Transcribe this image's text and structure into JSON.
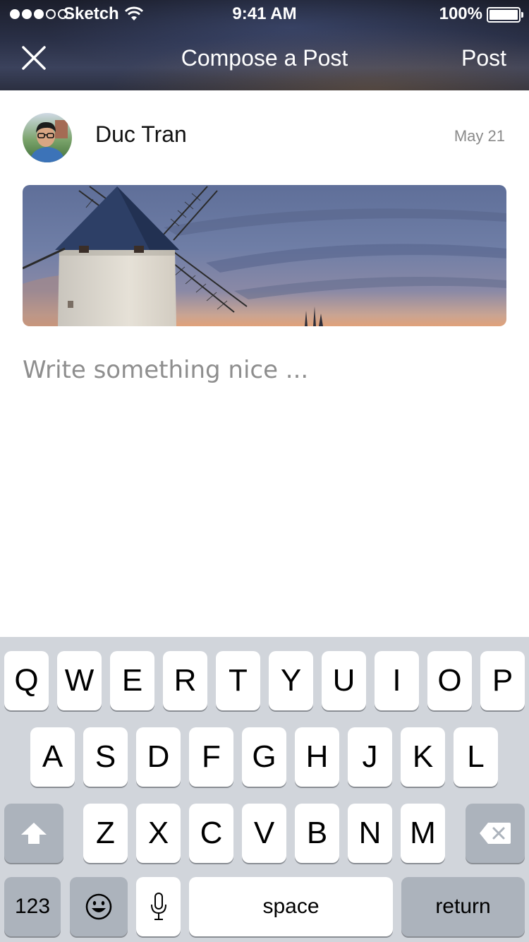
{
  "status_bar": {
    "signal_dots": [
      true,
      true,
      true,
      false,
      false
    ],
    "carrier": "Sketch",
    "time": "9:41 AM",
    "battery": "100%",
    "battery_level": 1.0
  },
  "nav": {
    "close_icon": "close-icon",
    "title": "Compose a Post",
    "post_label": "Post"
  },
  "post": {
    "author": "Duc Tran",
    "date": "May 21",
    "placeholder": "Write something nice ..."
  },
  "keyboard": {
    "row1": [
      "Q",
      "W",
      "E",
      "R",
      "T",
      "Y",
      "U",
      "I",
      "O",
      "P"
    ],
    "row2": [
      "A",
      "S",
      "D",
      "F",
      "G",
      "H",
      "J",
      "K",
      "L"
    ],
    "row3": [
      "Z",
      "X",
      "C",
      "V",
      "B",
      "N",
      "M"
    ],
    "numbers_label": "123",
    "space_label": "space",
    "return_label": "return",
    "shift_icon": "shift-icon",
    "delete_icon": "delete-icon",
    "emoji_icon": "emoji-icon",
    "mic_icon": "microphone-icon"
  },
  "colors": {
    "keyboard_bg": "#d1d5db",
    "key_dark": "#acb3bc",
    "placeholder": "#8e8e8e"
  }
}
